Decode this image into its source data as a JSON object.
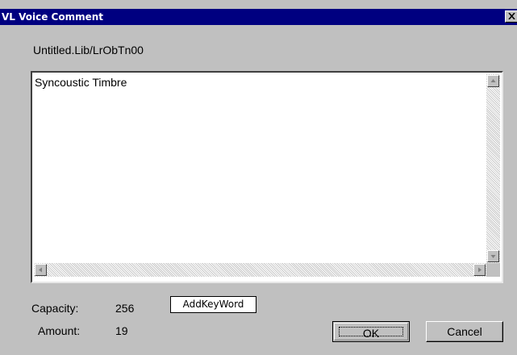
{
  "window": {
    "title": "VL Voice Comment",
    "close_icon": "close-icon"
  },
  "path": "Untitled.Lib/LrObTn00",
  "comment": {
    "text": "Syncoustic Timbre"
  },
  "stats": {
    "capacity_label": "Capacity:",
    "capacity_value": "256",
    "amount_label": "Amount:",
    "amount_value": "19"
  },
  "buttons": {
    "add_keyword": "AddKeyWord",
    "ok": "OK",
    "cancel": "Cancel"
  }
}
